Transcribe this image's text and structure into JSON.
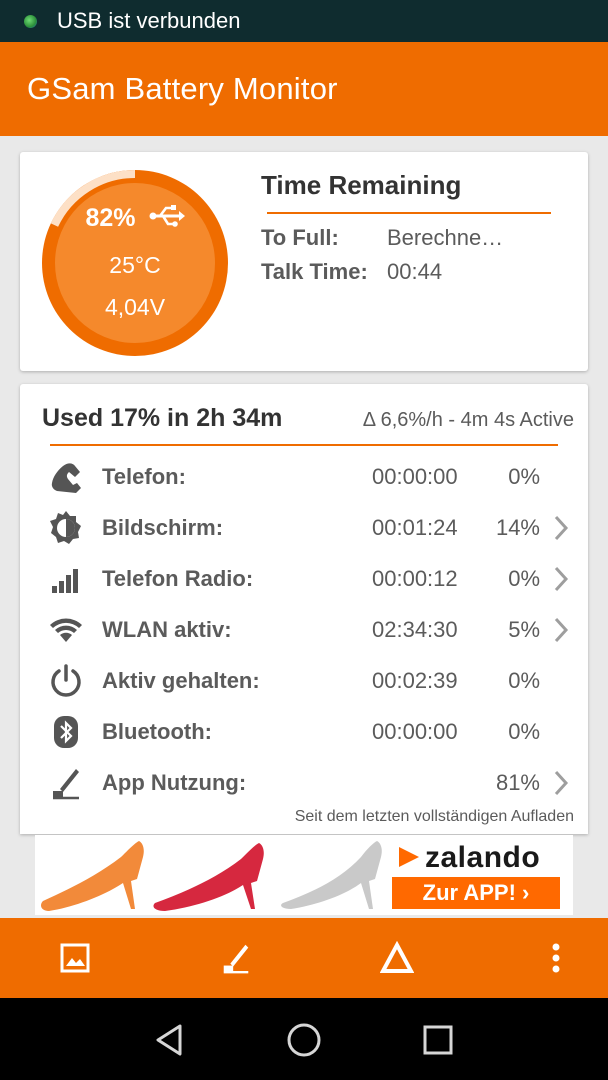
{
  "status_bar": {
    "text": "USB ist verbunden"
  },
  "app_bar": {
    "title": "GSam Battery Monitor"
  },
  "battery": {
    "percent_label": "82%",
    "level": 0.82,
    "temperature": "25°C",
    "voltage": "4,04V",
    "charging_icon": "usb-icon"
  },
  "time_remaining": {
    "title": "Time Remaining",
    "to_full_label": "To Full:",
    "to_full_value": "Berechne…",
    "talk_time_label": "Talk Time:",
    "talk_time_value": "00:44"
  },
  "usage": {
    "title": "Used 17% in 2h 34m",
    "rate": "Δ 6,6%/h - 4m 4s Active",
    "rows": [
      {
        "icon": "phone-icon",
        "label": "Telefon:",
        "time": "00:00:00",
        "percent": "0%",
        "chevron": false
      },
      {
        "icon": "brightness-icon",
        "label": "Bildschirm:",
        "time": "00:01:24",
        "percent": "14%",
        "chevron": true
      },
      {
        "icon": "signal-icon",
        "label": "Telefon Radio:",
        "time": "00:00:12",
        "percent": "0%",
        "chevron": true
      },
      {
        "icon": "wifi-icon",
        "label": "WLAN aktiv:",
        "time": "02:34:30",
        "percent": "5%",
        "chevron": true
      },
      {
        "icon": "power-icon",
        "label": "Aktiv gehalten:",
        "time": "00:02:39",
        "percent": "0%",
        "chevron": false
      },
      {
        "icon": "bluetooth-icon",
        "label": "Bluetooth:",
        "time": "00:00:00",
        "percent": "0%",
        "chevron": false
      },
      {
        "icon": "app-usage-icon",
        "label": "App Nutzung:",
        "time": "",
        "percent": "81%",
        "chevron": true
      }
    ],
    "footnote": "Seit dem letzten vollständigen Aufladen"
  },
  "ad": {
    "brand": "zalando",
    "button_label": "Zur APP! ›"
  },
  "bottom_bar": {
    "icons": [
      "image-icon",
      "app-usage-icon",
      "delta-icon",
      "more-vert-icon"
    ]
  },
  "nav_bar": {
    "icons": [
      "back-icon",
      "home-icon",
      "recents-icon"
    ]
  },
  "colors": {
    "accent": "#ef6c00",
    "status_bar": "#0f2c2f",
    "card": "#ffffff",
    "background": "#e9e9e9"
  }
}
